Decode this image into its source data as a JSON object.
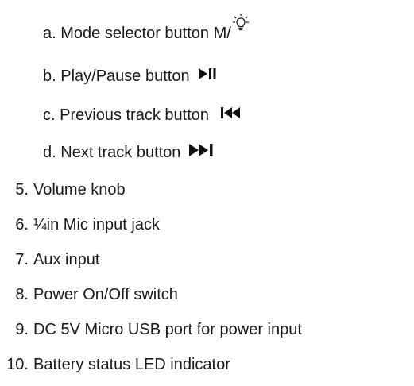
{
  "sub_items": [
    {
      "marker": "a.",
      "label": "Mode selector button M/",
      "icon": "lightbulb-icon"
    },
    {
      "marker": "b.",
      "label": "Play/Pause button",
      "icon": "play-pause-icon"
    },
    {
      "marker": "c.",
      "label": "Previous track button",
      "icon": "previous-track-icon"
    },
    {
      "marker": "d.",
      "label": "Next track button",
      "icon": "next-track-icon"
    }
  ],
  "numbered_items": [
    {
      "marker": "5.",
      "label": "Volume knob"
    },
    {
      "marker": "6.",
      "label": "¼in Mic input jack"
    },
    {
      "marker": "7.",
      "label": "Aux input"
    },
    {
      "marker": "8.",
      "label": "Power On/Off switch"
    },
    {
      "marker": "9.",
      "label": "DC 5V Micro USB port for power input"
    },
    {
      "marker": "10.",
      "label": "Battery status LED indicator"
    }
  ]
}
